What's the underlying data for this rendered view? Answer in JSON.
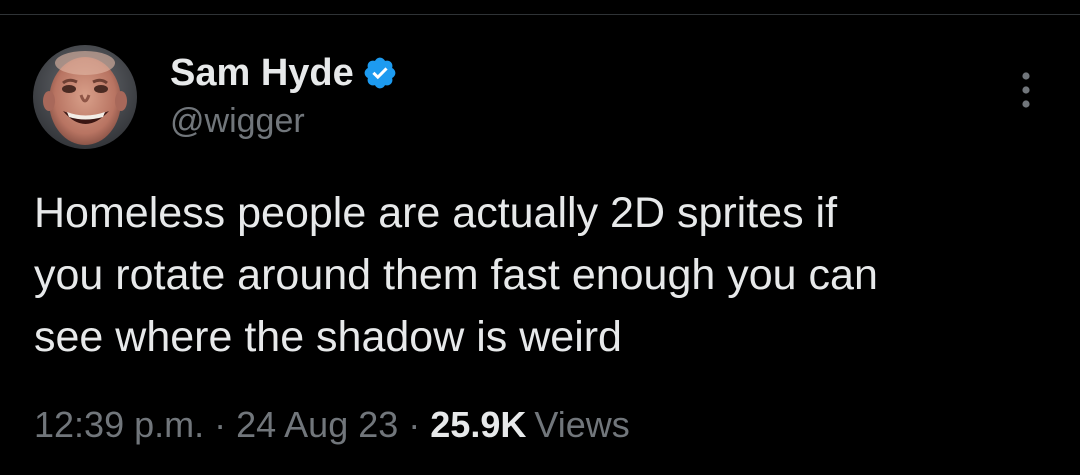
{
  "author": {
    "display_name": "Sam Hyde",
    "handle": "@wigger",
    "verified": true,
    "verified_icon": "verified-badge-icon",
    "verified_color": "#1d9bf0"
  },
  "tweet": {
    "text_lines": [
      "Homeless people are actually 2D sprites if",
      "you rotate around them fast enough you can",
      "see where the shadow is weird"
    ],
    "time": "12:39 p.m.",
    "separator": "·",
    "date": "24 Aug 23",
    "views_count": "25.9K",
    "views_label": "Views"
  },
  "menu": {
    "icon": "more-options-icon"
  },
  "colors": {
    "background": "#000000",
    "text_primary": "#e7e9ea",
    "text_secondary": "#71767b",
    "divider": "#2f3336"
  }
}
